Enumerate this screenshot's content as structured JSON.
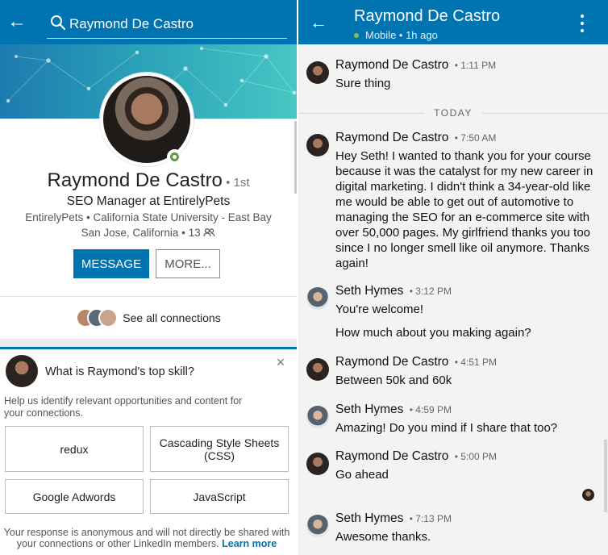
{
  "colors": {
    "brand": "#0073b1",
    "online": "#5f9b41"
  },
  "profile": {
    "search_value": "Raymond De Castro",
    "name": "Raymond De Castro",
    "degree": "1st",
    "headline": "SEO Manager at EntirelyPets",
    "company_school": "EntirelyPets • California State University - East Bay",
    "location": "San Jose, California • 13",
    "buttons": {
      "message": "MESSAGE",
      "more": "MORE..."
    },
    "connections_label": "See all connections"
  },
  "skill_card": {
    "question": "What is Raymond's top skill?",
    "help": "Help us identify relevant opportunities and content for your connections.",
    "options": [
      "redux",
      "Cascading Style Sheets (CSS)",
      "Google Adwords",
      "JavaScript"
    ],
    "note": "Your response is anonymous and will not directly be shared with your connections or other LinkedIn members.",
    "learn_more": "Learn more"
  },
  "chat": {
    "title": "Raymond De Castro",
    "status": "Mobile • 1h ago",
    "divider": "TODAY",
    "messages": [
      {
        "sender": "Raymond De Castro",
        "time": "1:11 PM",
        "text": "Sure thing"
      },
      {
        "sender": "Raymond De Castro",
        "time": "7:50 AM",
        "text": "Hey Seth! I wanted to thank you for your course because it was the catalyst for my new career in digital marketing. I didn't think a 34-year-old like me would be able to get out of automotive to managing the SEO for an e-commerce site with over 50,000 pages. My girlfriend thanks you too since I no longer smell like oil anymore. Thanks again!"
      },
      {
        "sender": "Seth Hymes",
        "time": "3:12 PM",
        "text": "You're welcome!",
        "text2": "How much about you making again?"
      },
      {
        "sender": "Raymond De Castro",
        "time": "4:51 PM",
        "text": "Between 50k and 60k"
      },
      {
        "sender": "Seth Hymes",
        "time": "4:59 PM",
        "text": "Amazing! Do you mind if I share that too?"
      },
      {
        "sender": "Raymond De Castro",
        "time": "5:00 PM",
        "text": "Go ahead"
      },
      {
        "sender": "Seth Hymes",
        "time": "7:13 PM",
        "text": "Awesome thanks."
      }
    ]
  }
}
